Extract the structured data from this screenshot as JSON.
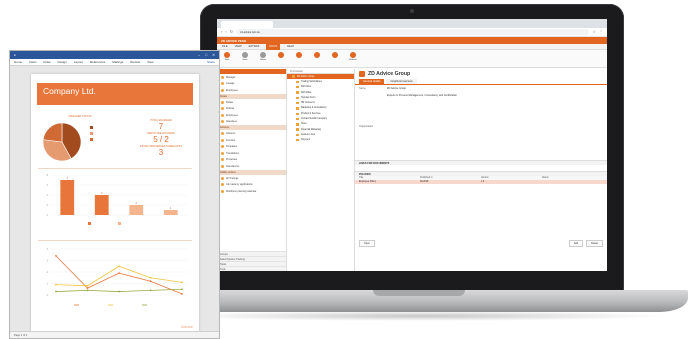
{
  "browser": {
    "tab_label": "",
    "url": "zd-advice.zeit.sw"
  },
  "app": {
    "brand": "ZD ADVICE PESO",
    "top_right_1": "",
    "top_right_2": "",
    "menu": [
      "FILE",
      "VIEW",
      "EXTRAS",
      "DOCS",
      "HELP"
    ],
    "menu_active_index": 3,
    "ribbon": [
      {
        "label": "New",
        "grey": false
      },
      {
        "label": "Save",
        "grey": true
      },
      {
        "label": "Delete",
        "grey": true
      },
      {
        "label": "",
        "grey": false
      },
      {
        "label": "",
        "grey": false
      },
      {
        "label": "",
        "grey": false
      },
      {
        "label": "",
        "grey": false
      },
      {
        "label": "Refresh",
        "grey": false
      }
    ],
    "nav_header": "",
    "nav_groups": [
      {
        "section": "",
        "items": [
          "Manager",
          "Lineage",
          "Employees"
        ]
      },
      {
        "section": "Rotate",
        "items": [
          "Rotate",
          "Policies",
          "Employees",
          "Attendees"
        ]
      },
      {
        "section": "Advance",
        "items": [
          "Advance",
          "Function",
          "Templates",
          "Translations",
          "Processes",
          "Attendances"
        ]
      },
      {
        "section": "Validity actions",
        "items": [
          "All Tracings",
          "Job vacancy applications",
          "Workforce planning calendar"
        ]
      }
    ],
    "nav_bottom": [
      "Groups",
      "Sales Pipeline Tracking",
      "Tasks",
      "Tools"
    ],
    "tree_search": "Find Details",
    "tree": [
      "ZD Advice Group",
      "Trading Subsidiaries",
      "Mid Cities",
      "Mid Office",
      "Hypotek Form",
      "HR Concerns",
      "Marketing & Consultancy",
      "Product & Services",
      "Contact Details Company",
      "Hotel",
      "Financial Marketing",
      "Feature Lines",
      "Payment"
    ],
    "tree_selected_index": 0,
    "detail": {
      "title": "ZD Advice Group",
      "tabs": [
        "General details",
        "Graphical overview"
      ],
      "name_label": "Name",
      "name_value": "ZD Advice Group",
      "org_label": "Organisation",
      "desc": "Experts in Process Management, Consultancy and Certification",
      "notes_1": "",
      "notes_2": "",
      "links_section": "LINKS FOR DOCUMENTS",
      "policies_section": "POLICIES",
      "policy_cols": [
        "Title",
        "Published in",
        "Version",
        "Status"
      ],
      "policy_row": [
        "Employee Policy",
        "01/2019",
        "1.0",
        ""
      ],
      "btn_open": "Open",
      "btn_add": "Add",
      "btn_delete": "Delete"
    }
  },
  "doc": {
    "title": "",
    "menu": [
      "Home",
      "Insert",
      "Draw",
      "Design",
      "Layout",
      "References",
      "Mailings",
      "Review",
      "View"
    ],
    "share": "Share",
    "status_left": "Page 1 of 1",
    "status_words": "",
    "status_zoom": "",
    "report": {
      "header_meta": "",
      "company": "Company Ltd.",
      "subtitle": "",
      "pie_title": "MANAGED STATUS",
      "stat_1_label": "TOTAL MANAGED",
      "stat_1_value": "7",
      "stat_2_label": "EMPLOYEE ROSTERS",
      "stat_2_value": "5 / 2",
      "stat_3_label": "INITIAL PROCESSES FORECASTS",
      "stat_3_value": "3",
      "bar_title": "",
      "line_title": "",
      "footer_left": "",
      "footer_right": "Advice"
    }
  },
  "chart_data": [
    {
      "type": "pie",
      "title": "MANAGED STATUS",
      "categories": [
        "",
        "",
        ""
      ],
      "values": [
        42,
        35,
        23
      ],
      "colors": [
        "#a24b1e",
        "#e59b6f",
        "#cf6a34"
      ]
    },
    {
      "type": "bar",
      "title": "",
      "categories": [
        "",
        "",
        "",
        ""
      ],
      "values": [
        7,
        4,
        2,
        1
      ],
      "ylim": [
        0,
        8
      ],
      "colors": [
        "#e8763a",
        "#e8763a",
        "#f4b48e",
        "#f4b48e"
      ],
      "legend": [
        "",
        ""
      ]
    },
    {
      "type": "line",
      "title": "",
      "x": [
        "",
        "",
        "",
        "",
        ""
      ],
      "series": [
        {
          "name": "",
          "color": "#e8763a",
          "values": [
            3.4,
            0.6,
            1.9,
            1.2,
            0.1
          ]
        },
        {
          "name": "",
          "color": "#f0c33c",
          "values": [
            0.9,
            0.8,
            2.5,
            1.5,
            1.1
          ]
        },
        {
          "name": "",
          "color": "#9aa83f",
          "values": [
            0.3,
            0.4,
            0.3,
            0.4,
            0.5
          ]
        }
      ],
      "ylim": [
        0,
        4
      ]
    }
  ]
}
